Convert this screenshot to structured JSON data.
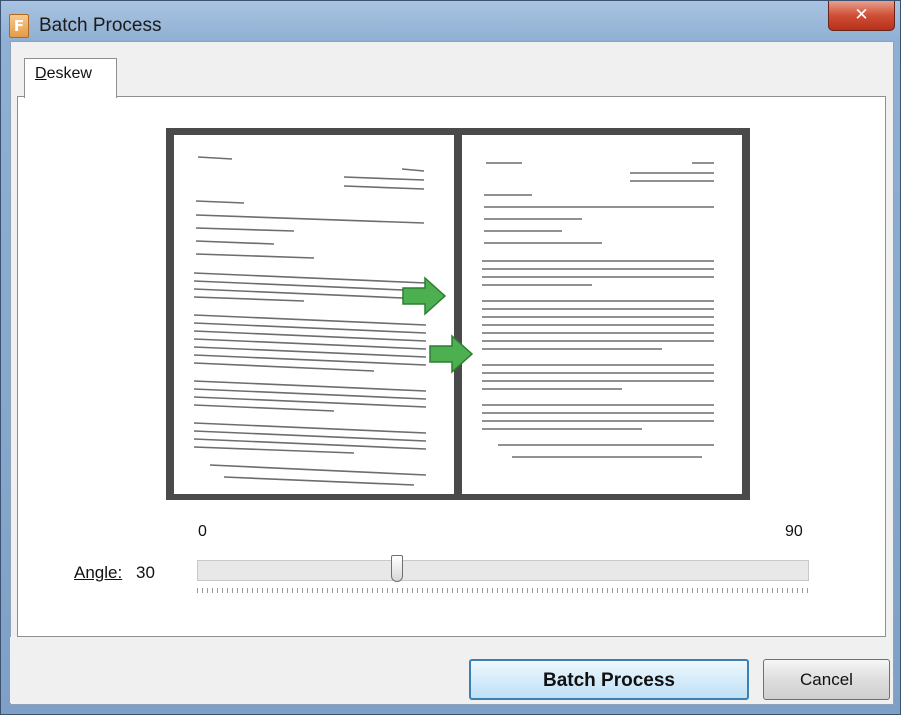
{
  "window": {
    "title": "Batch Process",
    "app_icon_glyph": "F"
  },
  "titlebar": {
    "close_glyph": "✕"
  },
  "tabs": [
    {
      "label": "Deskew",
      "selected": true
    }
  ],
  "preview": {
    "left_icon": "skewed-document-page",
    "right_icon": "straightened-document-page",
    "arrow_icon": "green-arrow-right",
    "frame_color": "#4a4a4a",
    "arrow_color": "#4caf50"
  },
  "slider": {
    "min_label": "0",
    "max_label": "90",
    "value_label": "Angle:",
    "value": "30"
  },
  "buttons": {
    "batch_process": "Batch Process",
    "cancel": "Cancel"
  }
}
